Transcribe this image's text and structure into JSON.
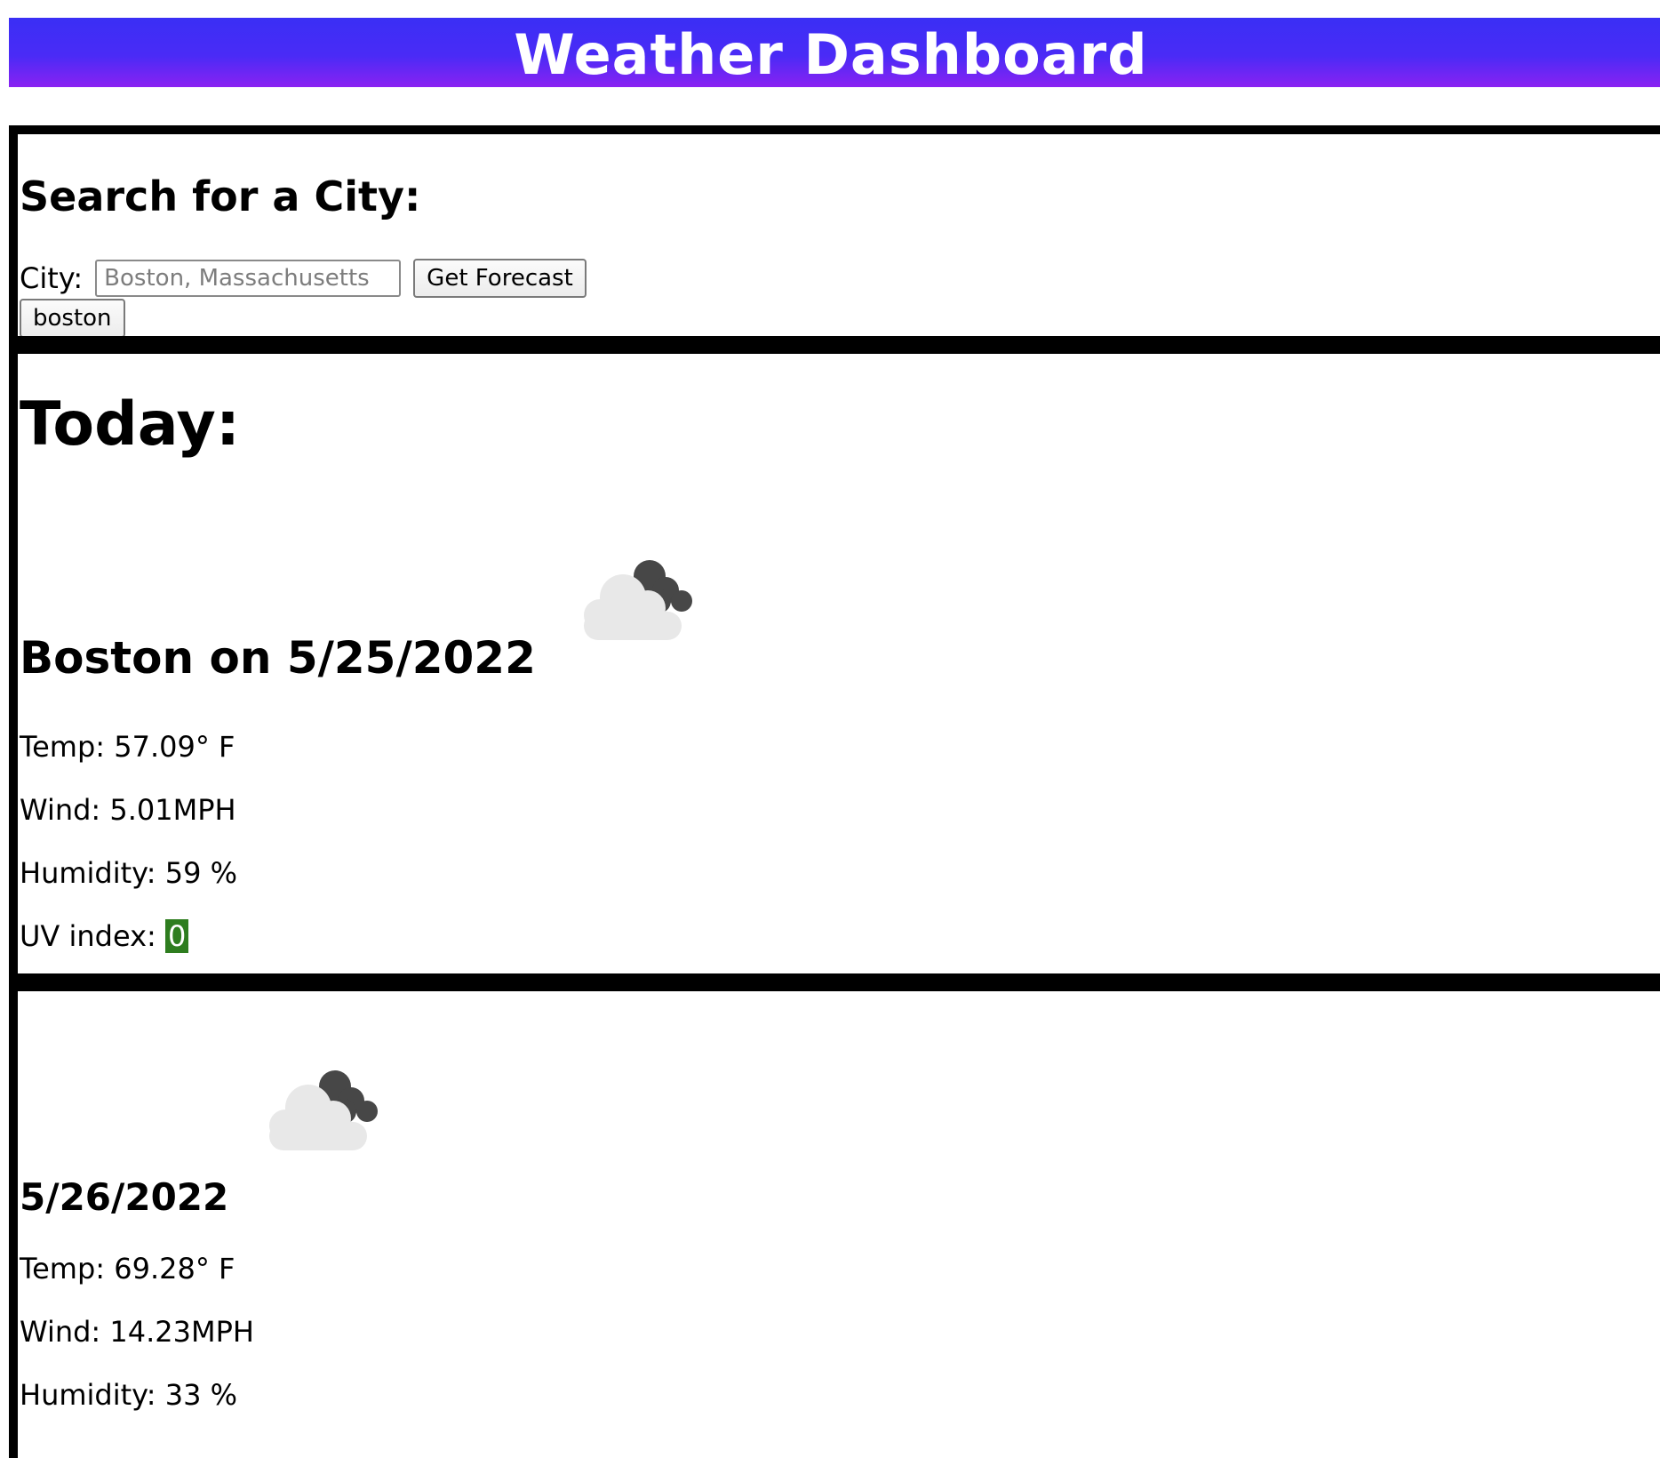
{
  "header": {
    "title": "Weather Dashboard",
    "gradient_top": "#3a2ff5",
    "gradient_bottom": "#8a22f2"
  },
  "search": {
    "title": "Search for a City:",
    "city_label": "City:",
    "city_placeholder": "Boston, Massachusetts",
    "city_value": "",
    "forecast_button_label": "Get Forecast",
    "history": [
      "boston"
    ]
  },
  "today": {
    "title": "Today:",
    "icon": "cloudy-night-icon",
    "heading": "Boston on 5/25/2022",
    "temp": "Temp: 57.09° F",
    "wind": "Wind: 5.01MPH",
    "humidity": "Humidity: 59 %",
    "uv_label": "UV index:",
    "uv_value": "0",
    "uv_color": "#2e7d1f"
  },
  "forecast": [
    {
      "icon": "cloudy-night-icon",
      "date": "5/26/2022",
      "temp": "Temp: 69.28° F",
      "wind": "Wind: 14.23MPH",
      "humidity": "Humidity: 33 %"
    }
  ]
}
